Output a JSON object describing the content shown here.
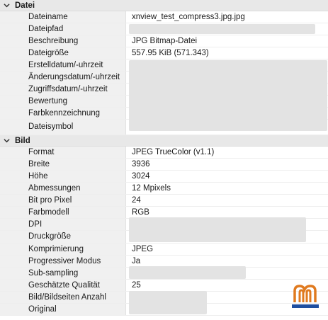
{
  "sections": {
    "datei": {
      "title": "Datei",
      "rows": [
        {
          "label": "Dateiname",
          "value": "xnview_test_compress3.jpg.jpg"
        },
        {
          "label": "Dateipfad",
          "value": ""
        },
        {
          "label": "Beschreibung",
          "value": "JPG Bitmap-Datei"
        },
        {
          "label": "Dateigröße",
          "value": "557.95 KiB (571.343)"
        },
        {
          "label": "Erstelldatum/-uhrzeit",
          "value": ""
        },
        {
          "label": "Änderungsdatum/-uhrzeit",
          "value": ""
        },
        {
          "label": "Zugriffsdatum/-uhrzeit",
          "value": ""
        },
        {
          "label": "Bewertung",
          "value": ""
        },
        {
          "label": "Farbkennzeichnung",
          "value": ""
        },
        {
          "label": "Dateisymbol",
          "value": ""
        }
      ]
    },
    "bild": {
      "title": "Bild",
      "rows": [
        {
          "label": "Format",
          "value": "JPEG TrueColor (v1.1)"
        },
        {
          "label": "Breite",
          "value": "3936"
        },
        {
          "label": "Höhe",
          "value": "3024"
        },
        {
          "label": "Abmessungen",
          "value": "12 Mpixels"
        },
        {
          "label": "Bit pro Pixel",
          "value": "24"
        },
        {
          "label": "Farbmodell",
          "value": "RGB"
        },
        {
          "label": "DPI",
          "value": ""
        },
        {
          "label": "Druckgröße",
          "value": ""
        },
        {
          "label": "Komprimierung",
          "value": "JPEG"
        },
        {
          "label": "Progressiver Modus",
          "value": "Ja"
        },
        {
          "label": "Sub-sampling",
          "value": ""
        },
        {
          "label": "Geschätzte Qualität",
          "value": "25"
        },
        {
          "label": "Bild/Bildseiten Anzahl",
          "value": ""
        },
        {
          "label": "Original",
          "value": ""
        }
      ]
    }
  },
  "colors": {
    "header_bg": "#e8e8e8",
    "label_bg": "#f0f0f0",
    "redacted": "#e3e3e3",
    "logo_orange": "#e07a1f",
    "logo_blue": "#1f4fa0"
  },
  "icons": {
    "section_toggle": "chevron-down-icon",
    "logo": "watermark-logo"
  }
}
